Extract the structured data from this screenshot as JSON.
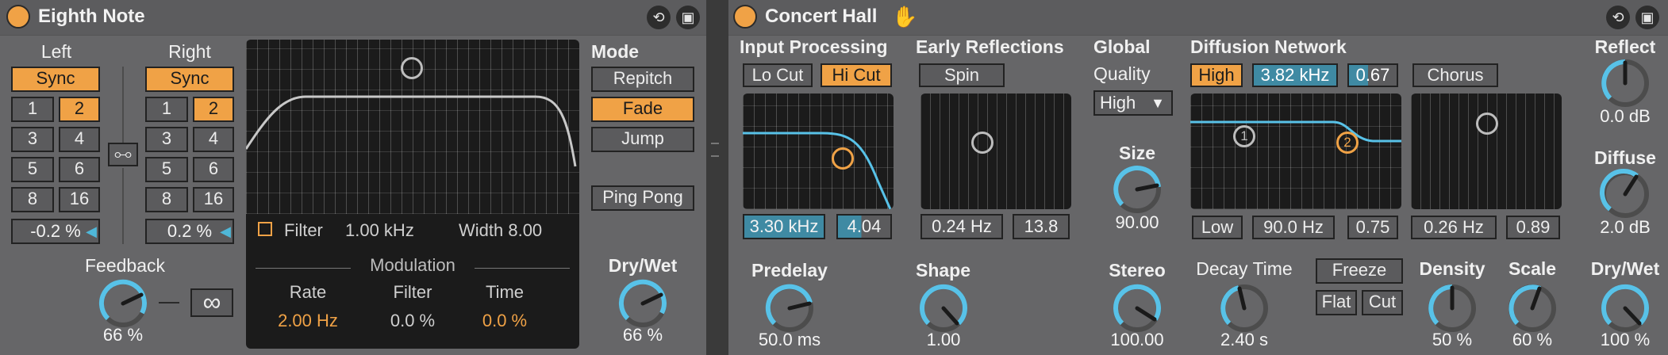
{
  "echo": {
    "title": "Eighth Note",
    "left_label": "Left",
    "right_label": "Right",
    "sync_label": "Sync",
    "left_grid": [
      "1",
      "2",
      "3",
      "4",
      "5",
      "6",
      "8",
      "16"
    ],
    "right_grid": [
      "1",
      "2",
      "3",
      "4",
      "5",
      "6",
      "8",
      "16"
    ],
    "left_offset": "-0.2 %",
    "right_offset": "0.2 %",
    "display": {
      "filter_label": "Filter",
      "filter_freq": "1.00 kHz",
      "width": "Width 8.00"
    },
    "modulation": {
      "title": "Modulation",
      "rate_label": "Rate",
      "filter_label": "Filter",
      "time_label": "Time",
      "rate": "2.00 Hz",
      "filter": "0.0 %",
      "time": "0.0 %"
    },
    "mode_label": "Mode",
    "mode_buttons": [
      "Repitch",
      "Fade",
      "Jump"
    ],
    "ping_pong": "Ping Pong",
    "feedback_label": "Feedback",
    "feedback": "66 %",
    "infinite": "∞",
    "drywet_label": "Dry/Wet",
    "drywet": "66 %",
    "feedback_level": 0.66,
    "drywet_level": 0.66
  },
  "reverb": {
    "title": "Concert Hall",
    "input": {
      "title": "Input Processing",
      "lo_cut": "Lo Cut",
      "hi_cut": "Hi Cut",
      "freq": "3.30 kHz",
      "q": "4.04",
      "predelay_label": "Predelay",
      "predelay": "50.0 ms"
    },
    "early": {
      "title": "Early Reflections",
      "spin": "Spin",
      "rate": "0.24 Hz",
      "amount": "13.8",
      "shape_label": "Shape",
      "shape": "1.00"
    },
    "global": {
      "title": "Global",
      "quality_label": "Quality",
      "quality": "High",
      "size_label": "Size",
      "size": "90.00",
      "stereo_label": "Stereo",
      "stereo": "100.00"
    },
    "diffusion": {
      "title": "Diffusion Network",
      "high": "High",
      "high_freq": "3.82 kHz",
      "high_val": "0.67",
      "chorus": "Chorus",
      "low": "Low",
      "low_freq": "90.0 Hz",
      "low_val": "0.75",
      "chorus_rate": "0.26 Hz",
      "chorus_amount": "0.89",
      "marker1": "1",
      "marker2": "2",
      "decay_label": "Decay Time",
      "decay": "2.40 s",
      "freeze": "Freeze",
      "flat": "Flat",
      "cut": "Cut",
      "density_label": "Density",
      "density": "50 %",
      "scale_label": "Scale",
      "scale": "60 %"
    },
    "reflect_label": "Reflect",
    "reflect": "0.0 dB",
    "diffuse_label": "Diffuse",
    "diffuse": "2.0 dB",
    "drywet_label": "Dry/Wet",
    "drywet": "100 %"
  }
}
